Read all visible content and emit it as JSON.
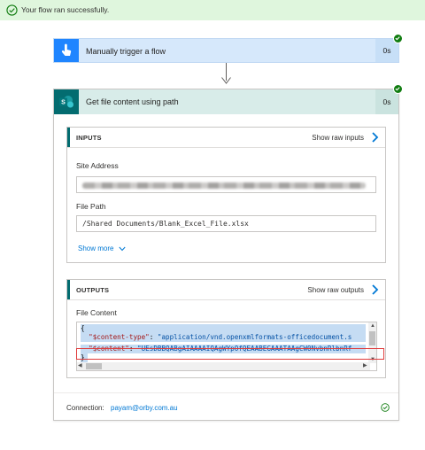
{
  "banner": {
    "message": "Your flow ran successfully.",
    "status_color": "#107c10"
  },
  "trigger": {
    "title": "Manually trigger a flow",
    "duration": "0s",
    "icon": "touch-hand-icon",
    "color": "#1f85ff"
  },
  "action": {
    "title": "Get file content using path",
    "duration": "0s",
    "icon": "sharepoint-icon",
    "color": "#036c70",
    "inputs": {
      "header": "INPUTS",
      "show_raw": "Show raw inputs",
      "site_address_label": "Site Address",
      "site_address_value": "",
      "file_path_label": "File Path",
      "file_path_value": "/Shared Documents/Blank_Excel_File.xlsx",
      "show_more": "Show more"
    },
    "outputs": {
      "header": "OUTPUTS",
      "show_raw": "Show raw outputs",
      "file_content_label": "File Content",
      "code": {
        "open_brace": "{",
        "line1_key": "\"$content-type\"",
        "line1_colon": ": ",
        "line1_value": "\"application/vnd.openxmlformats-officedocument.s",
        "line2_key": "\"$content\"",
        "line2_colon": ": ",
        "line2_value": "\"UEsDBBQABgAIAAAAIQAgWYpOfQEAABEGAAATAAgCW0NvbnRlbnRf",
        "close_brace": "}"
      }
    },
    "connection_label": "Connection:",
    "connection_email": "payam@orby.com.au"
  }
}
